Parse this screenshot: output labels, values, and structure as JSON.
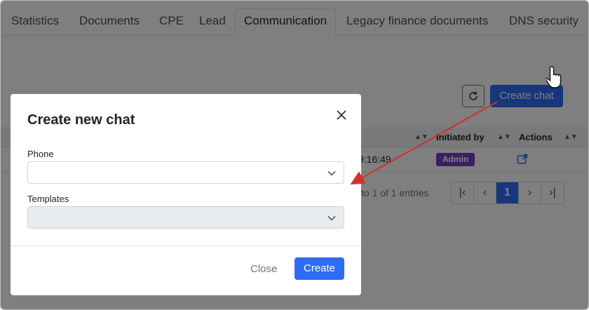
{
  "tabs": [
    {
      "label": "Statistics"
    },
    {
      "label": "Documents"
    },
    {
      "label": "CPE"
    },
    {
      "label": "Lead"
    },
    {
      "label": "Communication"
    },
    {
      "label": "Legacy finance documents"
    },
    {
      "label": "DNS security"
    }
  ],
  "toolbar": {
    "create_chat_label": "Create chat"
  },
  "table": {
    "headers": {
      "initiated_by": "Initiated by",
      "actions": "Actions"
    },
    "rows": [
      {
        "time": "9:16:49",
        "initiated_by": "Admin"
      }
    ],
    "entries_text": "to 1 of 1 entries"
  },
  "pagination": {
    "current_page": "1"
  },
  "modal": {
    "title": "Create new chat",
    "phone_label": "Phone",
    "phone_value": "",
    "templates_label": "Templates",
    "templates_value": "",
    "close_label": "Close",
    "create_label": "Create"
  },
  "colors": {
    "primary": "#2f6cf6",
    "badge": "#6f42c1",
    "annotation_arrow": "#d32f2f"
  }
}
